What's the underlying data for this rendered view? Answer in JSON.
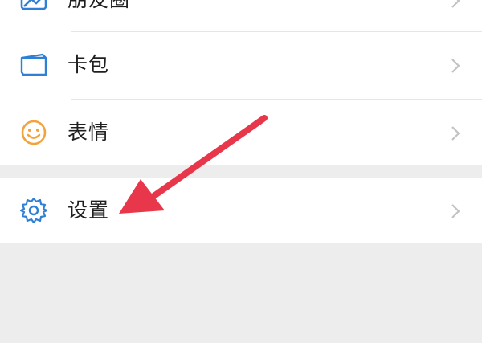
{
  "menu": {
    "items": [
      {
        "label": "朋友圈",
        "icon": "moments-icon"
      },
      {
        "label": "卡包",
        "icon": "card-wallet-icon"
      },
      {
        "label": "表情",
        "icon": "sticker-smiley-icon"
      }
    ],
    "settings": {
      "label": "设置",
      "icon": "gear-icon"
    }
  },
  "colors": {
    "icon_blue": "#2e7fd6",
    "sticker_orange": "#f2a33c",
    "chevron": "#c2c2c2",
    "annotation_arrow": "#e8374a",
    "page_background": "#ededed"
  },
  "annotation": {
    "shape": "red-arrow",
    "points_to": "设置"
  }
}
